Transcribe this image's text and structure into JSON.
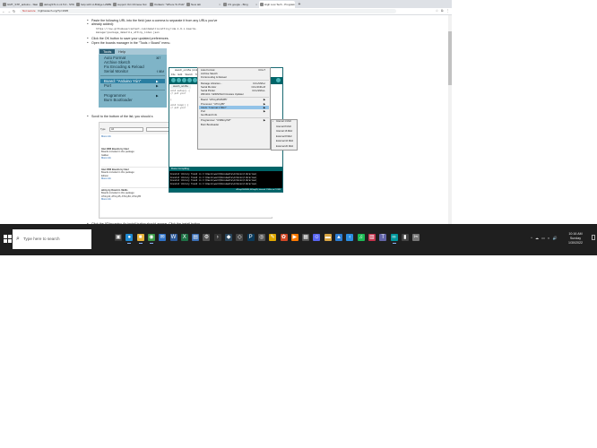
{
  "browser": {
    "tabs": [
      {
        "title": "GMT_STP_arduino - SketchUp",
        "active": false
      },
      {
        "title": "debugSTLm v1.5.0 - STCONTA",
        "active": false
      },
      {
        "title": "help with H-Bridge L298N",
        "active": false
      },
      {
        "title": "support Oct Chinese No",
        "active": false
      },
      {
        "title": "Outlaws: \"Where To Pick\"",
        "active": false
      },
      {
        "title": "New tab",
        "active": false
      },
      {
        "title": "CS google - Bing",
        "active": false
      },
      {
        "title": "High Low Tech - Program",
        "active": true
      }
    ],
    "window_buttons": [
      "—",
      "☐",
      "✕"
    ],
    "not_secure": "Not secure",
    "url": "highlowtech.org/?p=1695",
    "extension_icons": "☆ ⧉ ⋮"
  },
  "article": {
    "bullet1_line1": "Paste the following URL into the field (use a comma to separate it from any URLs you've",
    "bullet1_line2": "already added):",
    "code_line1": "https://raw.githubusercontent.com/damellis/attiny/ide-1.6.x-boards-",
    "code_line2": "manager/package_damellis_attiny_index.json",
    "bullet2": "Click the OK button to save your updated preferences.",
    "bullet3": "Open the boards manager in the \"Tools > Board\" menu.",
    "bullet4": "Scroll to the bottom of the list; you should s",
    "bullet5": "Click the ATtiny entry. An install button should appear. Click the install button."
  },
  "tools_image": {
    "menu_tools": "Tools",
    "menu_help": "Help",
    "items": [
      {
        "label": "Auto Format",
        "shortcut": "⌘T"
      },
      {
        "label": "Archive Sketch",
        "shortcut": ""
      },
      {
        "label": "Fix Encoding & Reload",
        "shortcut": ""
      },
      {
        "label": "Serial Monitor",
        "shortcut": "⇧⌘M"
      },
      {
        "label": "Board: \"Arduino Yún\"",
        "shortcut": "▶"
      },
      {
        "label": "Port",
        "shortcut": "▶"
      },
      {
        "label": "Programmer",
        "shortcut": "▶"
      },
      {
        "label": "Burn Bootloader",
        "shortcut": ""
      }
    ]
  },
  "library_image": {
    "type_label": "Type",
    "filter_value": "All",
    "more_info": "More info",
    "entries": [
      {
        "title": "Intel i686 Boards by Intel",
        "desc": "Boards included in this package:",
        "boards": "Galileo",
        "link": "More info"
      },
      {
        "title": "Intel i586 Boards by Intel",
        "desc": "Boards included in this package:",
        "boards": "Edison",
        "link": "More info"
      },
      {
        "title": "attiny by David A. Mellis",
        "desc": "Boards included in this package:",
        "boards": "ATtiny44, ATtiny45, ATtiny84, ATtiny85",
        "link": "More info"
      }
    ]
  },
  "ide": {
    "title": "sketch_oct15a | Arduino 1.6.7 (Windows Store 1.6.7.0)",
    "menu": [
      "File",
      "Edit",
      "Sketch",
      "Tools",
      "Help"
    ],
    "tab_label": "sketch_oct15a",
    "code": [
      "void setup() {",
      "  // put your",
      "",
      "}",
      "",
      "void loop() {",
      "  // put your"
    ],
    "status": "Done Compiling.",
    "console": [
      "Invalid library found in C:\\Users\\ward\\Documents\\Arduino\\libraries\\",
      "Invalid library found in C:\\Users\\ward\\Documents\\Arduino\\libraries\\",
      "Invalid library found in C:\\Users\\ward\\Documents\\Arduino\\libraries\\",
      "Invalid library found in C:\\Users\\ward\\Documents\\Arduino\\libraries\\"
    ],
    "footer": "ATtiny25/45/85, ATtiny85, Internal 1 MHz on COM3",
    "tools_menu": [
      {
        "label": "Auto Format",
        "key": "Ctrl+T"
      },
      {
        "label": "Archive Sketch",
        "key": ""
      },
      {
        "label": "Fix Encoding & Reload",
        "key": ""
      },
      {
        "label": "Manage Libraries...",
        "key": "Ctrl+Shift+I"
      },
      {
        "label": "Serial Monitor",
        "key": "Ctrl+Shift+M"
      },
      {
        "label": "Serial Plotter",
        "key": "Ctrl+Shift+L"
      },
      {
        "label": "WiFi101 / WiFiNINA Firmware Updater",
        "key": ""
      },
      {
        "label": "Board: \"ATtiny25/45/85\"",
        "key": "▶"
      },
      {
        "label": "Processor: \"ATtiny85\"",
        "key": "▶"
      },
      {
        "label": "Clock: \"Internal 1 MHz\"",
        "key": "▶"
      },
      {
        "label": "Port",
        "key": "▶"
      },
      {
        "label": "Get Board Info",
        "key": ""
      },
      {
        "label": "Programmer: \"USBtinyISP\"",
        "key": "▶"
      },
      {
        "label": "Burn Bootloader",
        "key": ""
      }
    ],
    "clock_options": [
      "Internal 1 MHz",
      "Internal 8 MHz",
      "Internal 16 MHz",
      "External 8 MHz",
      "External 16 MHz",
      "External 20 MHz"
    ]
  },
  "taskbar": {
    "search_placeholder": "Type here to search",
    "time": "10:16 AM",
    "day": "Sunday",
    "date": "1/30/2022",
    "tray_icons": "^ ☁ ▭ ◐ 🔊"
  },
  "colors": {
    "taskbar": "#1f1f1f",
    "ide_teal": "#006468",
    "menu_highlight": "#2a7ea2"
  }
}
